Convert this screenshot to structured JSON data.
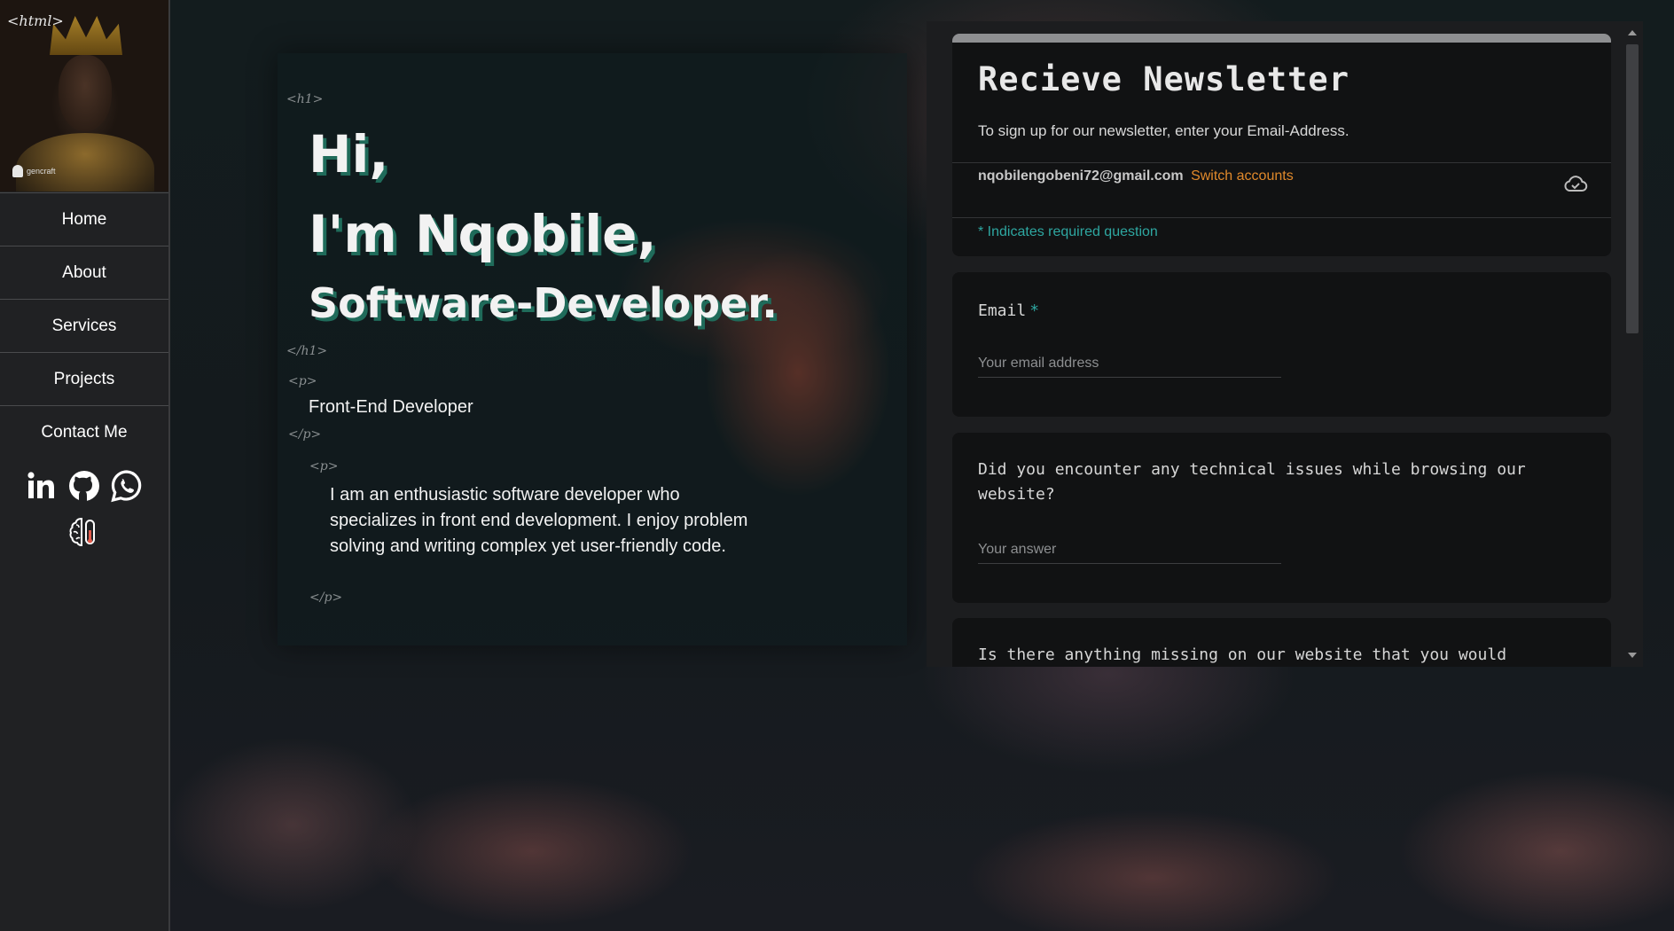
{
  "sidebar": {
    "profile": {
      "html_tag": "<html>",
      "brand": "gencraft"
    },
    "nav": [
      {
        "label": "Home"
      },
      {
        "label": "About"
      },
      {
        "label": "Services"
      },
      {
        "label": "Projects"
      },
      {
        "label": "Contact Me"
      }
    ],
    "socials": [
      "linkedin-icon",
      "github-icon",
      "whatsapp-icon"
    ],
    "extra_icon": "brain-icon"
  },
  "hero": {
    "tag_h1_open": "<h1>",
    "greeting": "Hi,",
    "name": "I'm Nqobile,",
    "role": "Software-Developer.",
    "tag_h1_close": "</h1>",
    "tag_p_open": "<p>",
    "subtitle": "Front-End Developer",
    "tag_p_close": "</p>",
    "tag_p2_open": "<p>",
    "intro": "I am an enthusiastic software developer who specializes in front end development. I enjoy problem solving and writing complex yet user-friendly code.",
    "tag_p2_close": "</p>"
  },
  "form": {
    "title": "Recieve Newsletter",
    "description": "To sign up for our newsletter, enter your Email-Address.",
    "account_email": "nqobilengobeni72@gmail.com",
    "switch_accounts": "Switch accounts",
    "required_note": "* Indicates required question",
    "questions": [
      {
        "label": "Email",
        "required": "*",
        "placeholder": "Your email address"
      },
      {
        "label": "Did you encounter any technical issues while browsing our website?",
        "placeholder": "Your answer"
      },
      {
        "label": "Is there anything missing on our website that you would"
      }
    ]
  },
  "colors": {
    "accent_teal": "#2ea7a1",
    "accent_orange": "#e0892b",
    "sidebar_bg": "#202123",
    "text_shadow": "#1f6b5a"
  }
}
